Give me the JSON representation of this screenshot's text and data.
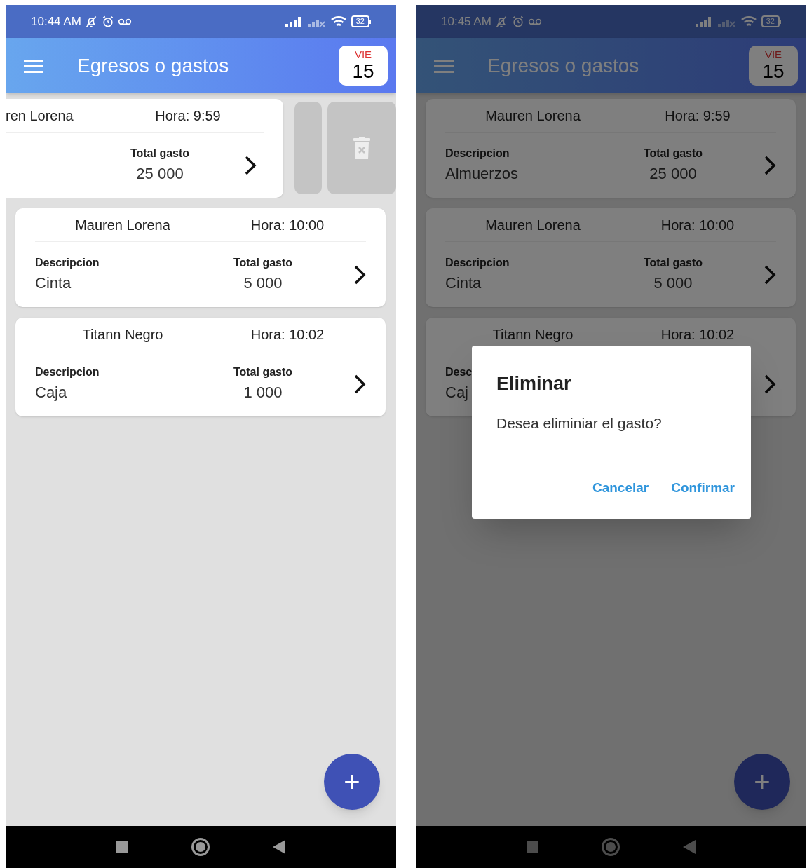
{
  "screens": [
    {
      "status_bar": {
        "time": "10:44 AM",
        "battery": "32"
      },
      "app_bar": {
        "title": "Egresos o gastos",
        "day_name": "VIE",
        "day_number": "15"
      },
      "expenses": [
        {
          "name": "ren Lorena",
          "time": "Hora: 9:59",
          "total_label": "Total gasto",
          "total": "25 000",
          "swiped": true
        },
        {
          "name": "Mauren Lorena",
          "time": "Hora: 10:00",
          "description_label": "Descripcion",
          "description": "Cinta",
          "total_label": "Total gasto",
          "total": "5 000",
          "swiped": false
        },
        {
          "name": "Titann Negro",
          "time": "Hora: 10:02",
          "description_label": "Descripcion",
          "description": "Caja",
          "total_label": "Total gasto",
          "total": "1 000",
          "swiped": false
        }
      ],
      "fab": "+"
    },
    {
      "status_bar": {
        "time": "10:45 AM",
        "battery": "32"
      },
      "app_bar": {
        "title": "Egresos o gastos",
        "day_name": "VIE",
        "day_number": "15"
      },
      "expenses": [
        {
          "name": "Mauren Lorena",
          "time": "Hora: 9:59",
          "description_label": "Descripcion",
          "description": "Almuerzos",
          "total_label": "Total gasto",
          "total": "25 000",
          "swiped": false
        },
        {
          "name": "Mauren Lorena",
          "time": "Hora: 10:00",
          "description_label": "Descripcion",
          "description": "Cinta",
          "total_label": "Total gasto",
          "total": "5 000",
          "swiped": false
        },
        {
          "name": "Titann Negro",
          "time": "Hora: 10:02",
          "description_label": "Desc",
          "description": "Caj",
          "swiped": false
        }
      ],
      "fab": "+",
      "dialog": {
        "title": "Eliminar",
        "message": "Desea eliminiar el gasto?",
        "buttons": [
          "Cancelar",
          "Confirmar"
        ]
      }
    }
  ]
}
